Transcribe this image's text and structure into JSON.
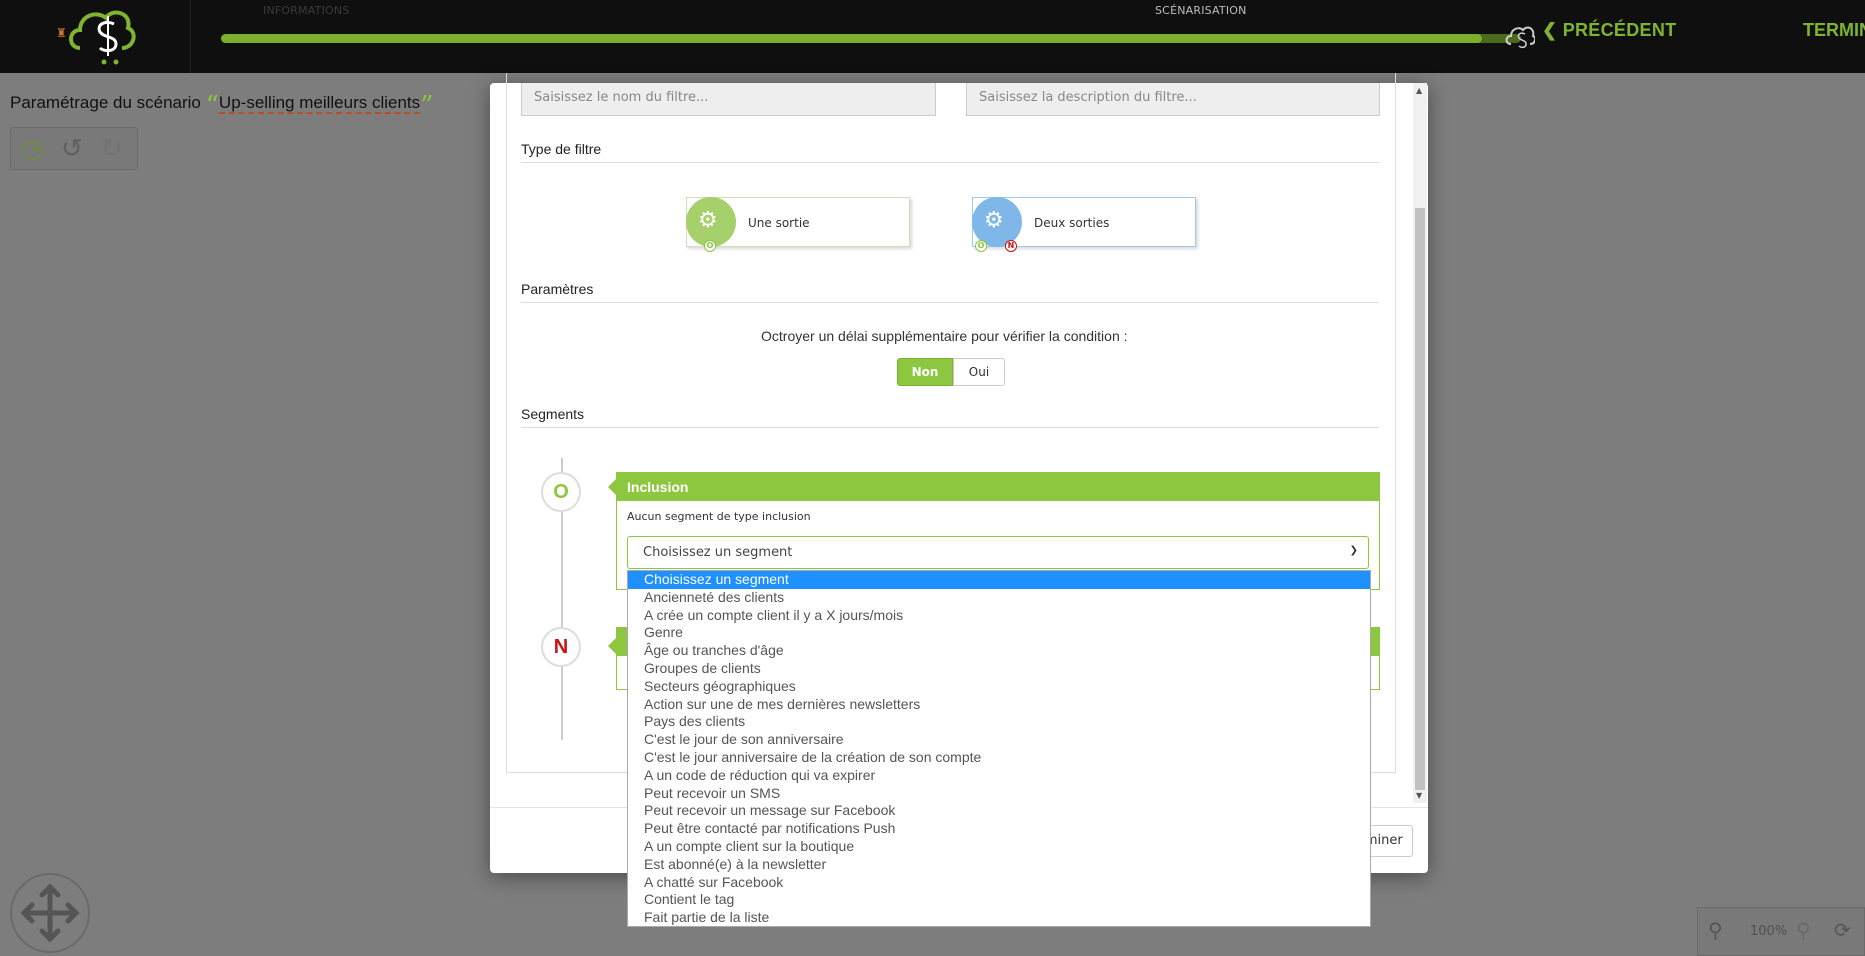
{
  "topbar": {
    "steps": [
      "INFORMATIONS",
      "SCÉNARISATION"
    ],
    "progress_fraction": 0.97,
    "prev_label": "PRÉCÉDENT",
    "next_label": "TERMIN"
  },
  "page": {
    "title_prefix": "Paramétrage du scénario",
    "scenario_name": "Up-selling meilleurs clients",
    "open_quote": "“",
    "close_quote": "”"
  },
  "zoom": {
    "level": "100%"
  },
  "modal": {
    "name_placeholder": "Saisissez le nom du filtre...",
    "description_placeholder": "Saisissez la description du filtre...",
    "filter_type_heading": "Type de filtre",
    "filter_types": [
      {
        "label": "Une sortie",
        "color": "#a5d06b"
      },
      {
        "label": "Deux sorties",
        "color": "#7fb8e8"
      }
    ],
    "dot_o": "O",
    "dot_n": "N",
    "params_heading": "Paramètres",
    "delay_question": "Octroyer un délai supplémentaire pour vérifier la condition :",
    "toggle_no": "Non",
    "toggle_yes": "Oui",
    "segments_heading": "Segments",
    "inclusion_node": "O",
    "exclusion_node": "N",
    "inclusion_title": "Inclusion",
    "inclusion_empty": "Aucun segment de type inclusion",
    "segment_select_value": "Choisissez un segment",
    "finish_button": "Terminer"
  },
  "segment_options": [
    "Choisissez un segment",
    "Ancienneté des clients",
    "A crée un compte client il y a X jours/mois",
    "Genre",
    "Âge ou tranches d'âge",
    "Groupes de clients",
    "Secteurs géographiques",
    "Action sur une de mes dernières newsletters",
    "Pays des clients",
    "C'est le jour de son anniversaire",
    "C'est le jour anniversaire de la création de son compte",
    "A un code de réduction qui va expirer",
    "Peut recevoir un SMS",
    "Peut recevoir un message sur Facebook",
    "Peut être contacté par notifications Push",
    "A un compte client sur la boutique",
    "Est abonné(e) à la newsletter",
    "A chatté sur Facebook",
    "Contient le tag",
    "Fait partie de la liste"
  ],
  "colors": {
    "brand_green": "#8dc63f",
    "dropdown_selected": "#1e90ff",
    "exclusion_red": "#cc1111"
  }
}
